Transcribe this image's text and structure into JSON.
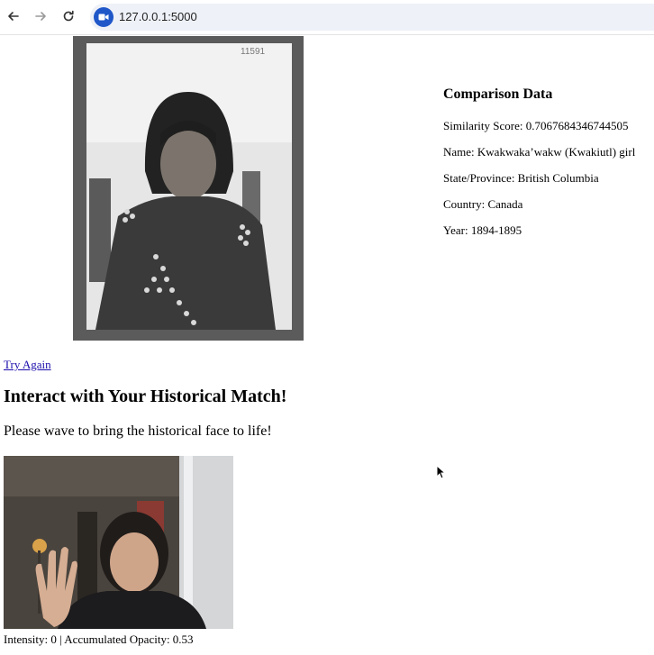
{
  "browser": {
    "url": "127.0.0.1:5000"
  },
  "comparison": {
    "heading": "Comparison Data",
    "similarity": "Similarity Score: 0.7067684346744505",
    "name": "Name: Kwakwaka’wakw (Kwakiutl) girl",
    "state": "State/Province: British Columbia",
    "country": "Country: Canada",
    "year": "Year: 1894-1895"
  },
  "portrait": {
    "corner_note": "11591"
  },
  "links": {
    "try_again": "Try Again"
  },
  "interact": {
    "title": "Interact with Your Historical Match!",
    "instruction": "Please wave to bring the historical face to life!",
    "status": "Intensity: 0 | Accumulated Opacity: 0.53"
  }
}
